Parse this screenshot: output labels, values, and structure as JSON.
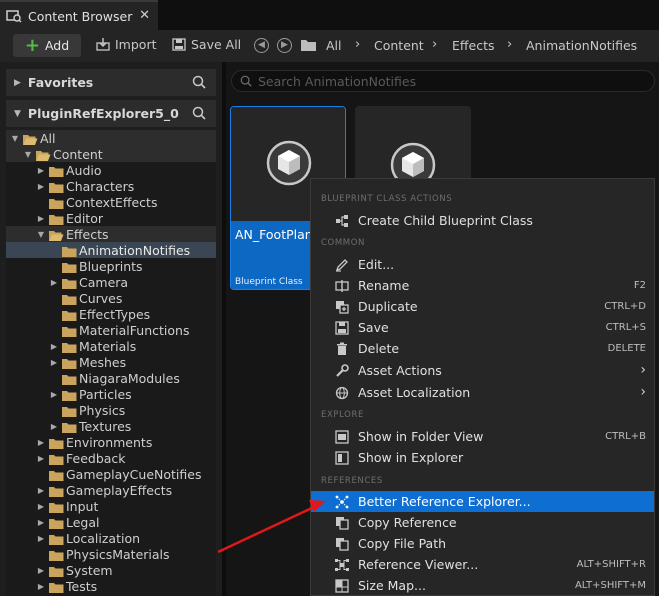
{
  "tab": {
    "title": "Content Browser",
    "close": "✕"
  },
  "toolbar": {
    "add_label": "Add",
    "import_label": "Import",
    "save_all_label": "Save All",
    "breadcrumb": [
      "All",
      "Content",
      "Effects",
      "AnimationNotifies"
    ]
  },
  "sidebar": {
    "favorites_label": "Favorites",
    "project_label": "PluginRefExplorer5_0",
    "tree": [
      {
        "label": "All",
        "indent": 0,
        "twisty": "open",
        "state": "hl"
      },
      {
        "label": "Content",
        "indent": 1,
        "twisty": "open",
        "state": "hl"
      },
      {
        "label": "Audio",
        "indent": 2,
        "twisty": "closed"
      },
      {
        "label": "Characters",
        "indent": 2,
        "twisty": "closed"
      },
      {
        "label": "ContextEffects",
        "indent": 2,
        "twisty": "none"
      },
      {
        "label": "Editor",
        "indent": 2,
        "twisty": "closed"
      },
      {
        "label": "Effects",
        "indent": 2,
        "twisty": "open",
        "state": "hl"
      },
      {
        "label": "AnimationNotifies",
        "indent": 3,
        "twisty": "none",
        "state": "sel"
      },
      {
        "label": "Blueprints",
        "indent": 3,
        "twisty": "none"
      },
      {
        "label": "Camera",
        "indent": 3,
        "twisty": "closed"
      },
      {
        "label": "Curves",
        "indent": 3,
        "twisty": "none"
      },
      {
        "label": "EffectTypes",
        "indent": 3,
        "twisty": "none"
      },
      {
        "label": "MaterialFunctions",
        "indent": 3,
        "twisty": "none"
      },
      {
        "label": "Materials",
        "indent": 3,
        "twisty": "closed"
      },
      {
        "label": "Meshes",
        "indent": 3,
        "twisty": "closed"
      },
      {
        "label": "NiagaraModules",
        "indent": 3,
        "twisty": "none"
      },
      {
        "label": "Particles",
        "indent": 3,
        "twisty": "closed"
      },
      {
        "label": "Physics",
        "indent": 3,
        "twisty": "none"
      },
      {
        "label": "Textures",
        "indent": 3,
        "twisty": "closed"
      },
      {
        "label": "Environments",
        "indent": 2,
        "twisty": "closed"
      },
      {
        "label": "Feedback",
        "indent": 2,
        "twisty": "closed"
      },
      {
        "label": "GameplayCueNotifies",
        "indent": 2,
        "twisty": "none"
      },
      {
        "label": "GameplayEffects",
        "indent": 2,
        "twisty": "closed"
      },
      {
        "label": "Input",
        "indent": 2,
        "twisty": "closed"
      },
      {
        "label": "Legal",
        "indent": 2,
        "twisty": "closed"
      },
      {
        "label": "Localization",
        "indent": 2,
        "twisty": "closed"
      },
      {
        "label": "PhysicsMaterials",
        "indent": 2,
        "twisty": "none"
      },
      {
        "label": "System",
        "indent": 2,
        "twisty": "closed"
      },
      {
        "label": "Tests",
        "indent": 2,
        "twisty": "closed"
      }
    ]
  },
  "content": {
    "search_placeholder": "Search AnimationNotifies",
    "assets": [
      {
        "name": "AN_FootPlant",
        "type": "Blueprint Class"
      }
    ]
  },
  "context_menu": {
    "sections": {
      "blueprint": "BLUEPRINT CLASS ACTIONS",
      "common": "COMMON",
      "explore": "EXPLORE",
      "references": "REFERENCES"
    },
    "items": {
      "create_child": {
        "label": "Create Child Blueprint Class",
        "icon": "blueprint-icon"
      },
      "edit": {
        "label": "Edit...",
        "icon": "pencil-icon"
      },
      "rename": {
        "label": "Rename",
        "shortcut": "F2",
        "icon": "rename-icon"
      },
      "duplicate": {
        "label": "Duplicate",
        "shortcut": "CTRL+D",
        "icon": "duplicate-icon"
      },
      "save": {
        "label": "Save",
        "shortcut": "CTRL+S",
        "icon": "save-icon"
      },
      "delete": {
        "label": "Delete",
        "shortcut": "DELETE",
        "icon": "trash-icon"
      },
      "asset_actions": {
        "label": "Asset Actions",
        "icon": "wrench-icon"
      },
      "asset_localization": {
        "label": "Asset Localization",
        "icon": "globe-icon"
      },
      "show_folder": {
        "label": "Show in Folder View",
        "shortcut": "CTRL+B",
        "icon": "folder-view-icon"
      },
      "show_explorer": {
        "label": "Show in Explorer",
        "icon": "explorer-icon"
      },
      "better_ref": {
        "label": "Better Reference Explorer...",
        "icon": "graph-icon"
      },
      "copy_ref": {
        "label": "Copy Reference",
        "icon": "copy-icon"
      },
      "copy_path": {
        "label": "Copy File Path",
        "icon": "copy-icon"
      },
      "ref_viewer": {
        "label": "Reference Viewer...",
        "shortcut": "ALT+SHIFT+R",
        "icon": "graph-icon"
      },
      "size_map": {
        "label": "Size Map...",
        "shortcut": "ALT+SHIFT+M",
        "icon": "sizemap-icon"
      }
    }
  },
  "colors": {
    "accent": "#0e6ed1",
    "add_green": "#58b84a",
    "folder": "#c9a45a",
    "annotation_arrow": "#e01818"
  }
}
